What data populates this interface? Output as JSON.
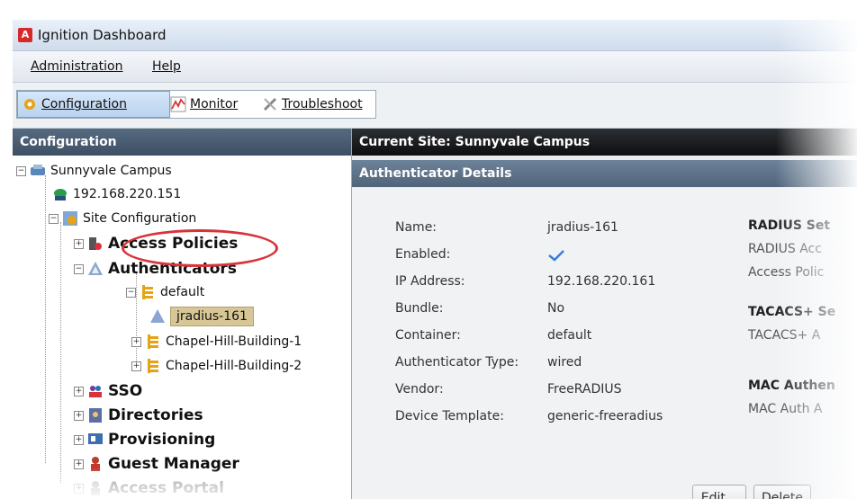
{
  "window": {
    "logo_letter": "A",
    "title": "Ignition Dashboard"
  },
  "menu": [
    {
      "label": "Administration"
    },
    {
      "label": "Help"
    }
  ],
  "toolbar": {
    "configuration": "Configuration",
    "monitor": "Monitor",
    "troubleshoot": "Troubleshoot"
  },
  "left_panel": {
    "header": "Configuration",
    "tree": {
      "site": "Sunnyvale Campus",
      "ip": "192.168.220.151",
      "site_config": "Site Configuration",
      "access_policies": "Access Policies",
      "authenticators": "Authenticators",
      "default": "default",
      "jradius": "jradius-161",
      "chapel1": "Chapel-Hill-Building-1",
      "chapel2": "Chapel-Hill-Building-2",
      "sso": "SSO",
      "directories": "Directories",
      "provisioning": "Provisioning",
      "guest_manager": "Guest Manager",
      "access_portal": "Access Portal"
    }
  },
  "right_panel": {
    "site_header": "Current Site:  Sunnyvale Campus",
    "details_header": "Authenticator Details",
    "fields": [
      {
        "label": "Name:",
        "value": "jradius-161"
      },
      {
        "label": "Enabled:",
        "value": ""
      },
      {
        "label": "IP Address:",
        "value": "192.168.220.161"
      },
      {
        "label": "Bundle:",
        "value": "No"
      },
      {
        "label": "Container:",
        "value": "default"
      },
      {
        "label": "Authenticator Type:",
        "value": "wired"
      },
      {
        "label": "Vendor:",
        "value": "FreeRADIUS"
      },
      {
        "label": "Device Template:",
        "value": "generic-freeradius"
      }
    ],
    "sections": {
      "radius_head": "RADIUS Set",
      "radius_item1": "RADIUS Acc",
      "radius_item2": "Access Polic",
      "tacacs_head": "TACACS+ Se",
      "tacacs_item": "TACACS+ A",
      "mac_head": "MAC Authen",
      "mac_item": "MAC Auth A"
    },
    "buttons": {
      "edit": "Edit...",
      "delete": "Delete"
    }
  },
  "colors": {
    "accent": "#d8333a",
    "selected": "#d8c796",
    "check": "#3b7dd8"
  }
}
